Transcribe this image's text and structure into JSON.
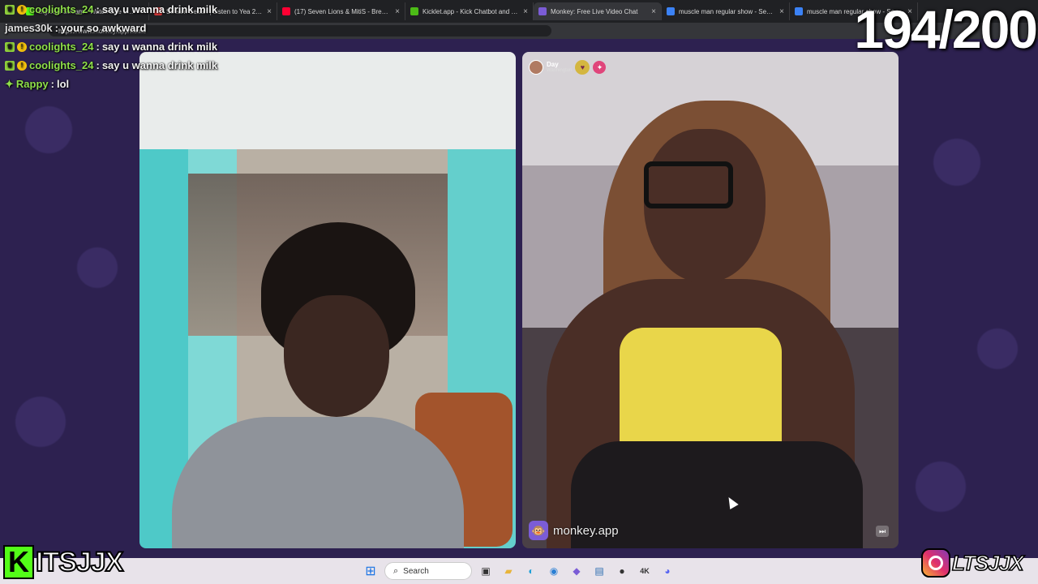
{
  "browser": {
    "tabs": [
      {
        "title": "Bigloaal Stream - Watch Live on K",
        "color": "#53fc18"
      },
      {
        "title": "Stream Seaan | Listen to Yea 2 pla",
        "color": "#e23b3b"
      },
      {
        "title": "(17) Seven Lions & MitiS - Break T",
        "color": "#ff0033"
      },
      {
        "title": "Kicklet.app - Kick Chatbot and Ov",
        "color": "#4cbb17"
      },
      {
        "title": "Monkey: Free Live Video Chat",
        "color": "#7b5cd6"
      },
      {
        "title": "muscle man regular show - Search",
        "color": "#3b82f6"
      },
      {
        "title": "muscle man regular show - Search",
        "color": "#3b82f6"
      }
    ],
    "url": "https://www.monkey.app/home"
  },
  "chat": [
    {
      "user": "coolights_24",
      "message": "say u wanna drink milk",
      "badges": true,
      "color": "green"
    },
    {
      "user": "james30k",
      "message": "your so awkward",
      "badges": false,
      "color": "gray"
    },
    {
      "user": "coolights_24",
      "message": "say u wanna drink milk",
      "badges": true,
      "color": "green"
    },
    {
      "user": "coolights_24",
      "message": "say u wanna drink milk",
      "badges": true,
      "color": "green"
    },
    {
      "user": "Rappy",
      "message": "lol",
      "badges": false,
      "color": "green"
    }
  ],
  "counter": "194/200",
  "remote_user": {
    "name": "Day",
    "location": "Washington"
  },
  "watermark": "monkey.app",
  "taskbar": {
    "search_label": "Search"
  },
  "branding": {
    "kick_handle": "ITSJJX",
    "ig_handle": "LTSJJX"
  }
}
